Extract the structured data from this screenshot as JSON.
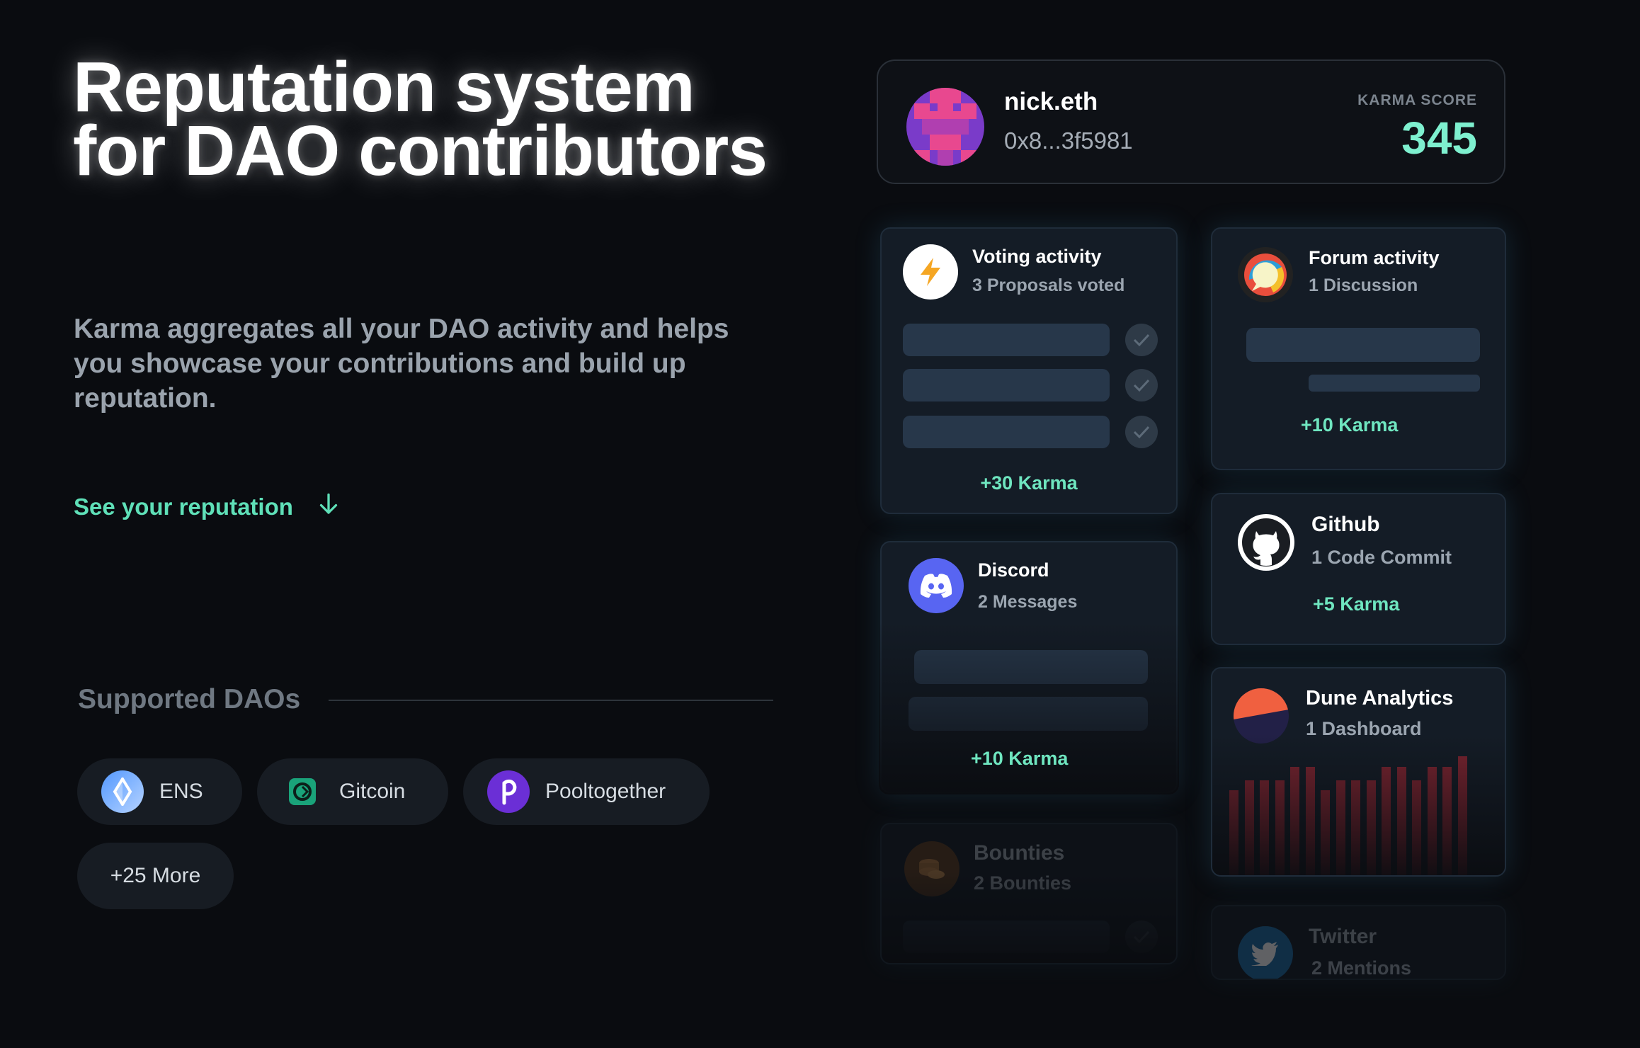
{
  "hero": {
    "title": "Reputation system for DAO contributors",
    "subtitle": "Karma aggregates all your DAO activity and helps you showcase your contributions and build up reputation.",
    "cta_label": "See your reputation"
  },
  "daos": {
    "heading": "Supported DAOs",
    "items": [
      {
        "label": "ENS",
        "icon": "ens-icon"
      },
      {
        "label": "Gitcoin",
        "icon": "gitcoin-icon"
      },
      {
        "label": "Pooltogether",
        "icon": "pooltogether-icon"
      }
    ],
    "more_label": "+25 More"
  },
  "profile": {
    "name": "nick.eth",
    "address": "0x8...3f5981",
    "score_label": "KARMA SCORE",
    "score": "345"
  },
  "cards": {
    "voting": {
      "title": "Voting activity",
      "subtitle": "3 Proposals voted",
      "karma": "+30 Karma",
      "icon": "lightning-icon"
    },
    "forum": {
      "title": "Forum activity",
      "subtitle": "1 Discussion",
      "karma": "+10 Karma",
      "icon": "chat-bubble-icon"
    },
    "github": {
      "title": "Github",
      "subtitle": "1 Code Commit",
      "karma": "+5 Karma",
      "icon": "github-icon"
    },
    "discord": {
      "title": "Discord",
      "subtitle": "2 Messages",
      "karma": "+10 Karma",
      "icon": "discord-icon"
    },
    "dune": {
      "title": "Dune Analytics",
      "subtitle": "1 Dashboard",
      "icon": "dune-icon",
      "bar_levels": [
        0.72,
        0.8,
        0.8,
        0.8,
        0.91,
        0.91,
        0.72,
        0.8,
        0.8,
        0.8,
        0.91,
        0.91,
        0.8,
        0.91,
        0.91,
        1.0
      ]
    },
    "bounties": {
      "title": "Bounties",
      "subtitle": "2 Bounties",
      "icon": "coins-icon"
    },
    "twitter": {
      "title": "Twitter",
      "subtitle": "2 Mentions",
      "icon": "twitter-icon"
    }
  },
  "colors": {
    "accent": "#5fe0b8",
    "score": "#7ef0cf",
    "background": "#0a0c10",
    "card": "#141c26"
  }
}
